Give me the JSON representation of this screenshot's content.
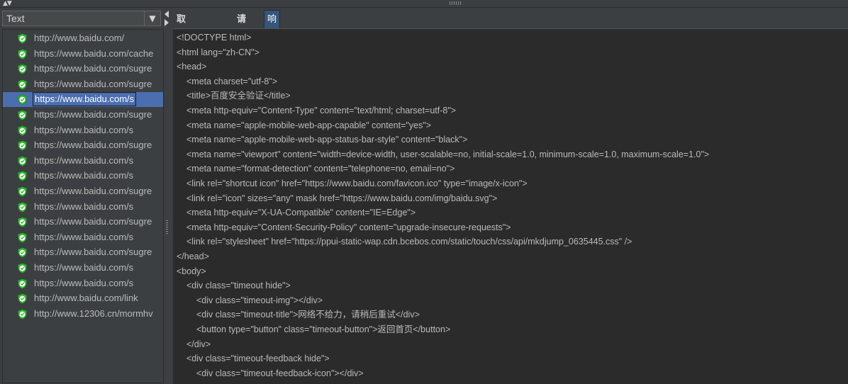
{
  "left_panel": {
    "renderer_select": {
      "value": "Text"
    },
    "results": [
      {
        "label": "http://www.baidu.com/"
      },
      {
        "label": "https://www.baidu.com/cache"
      },
      {
        "label": "https://www.baidu.com/sugre"
      },
      {
        "label": "https://www.baidu.com/sugre"
      },
      {
        "label": "https://www.baidu.com/s",
        "selected": true
      },
      {
        "label": "https://www.baidu.com/sugre"
      },
      {
        "label": "https://www.baidu.com/s"
      },
      {
        "label": "https://www.baidu.com/sugre"
      },
      {
        "label": "https://www.baidu.com/s"
      },
      {
        "label": "https://www.baidu.com/s"
      },
      {
        "label": "https://www.baidu.com/sugre"
      },
      {
        "label": "https://www.baidu.com/s"
      },
      {
        "label": "https://www.baidu.com/sugre"
      },
      {
        "label": "https://www.baidu.com/s"
      },
      {
        "label": "https://www.baidu.com/sugre"
      },
      {
        "label": "https://www.baidu.com/s"
      },
      {
        "label": "https://www.baidu.com/s"
      },
      {
        "label": "http://www.baidu.com/link"
      },
      {
        "label": "http://www.12306.cn/mormhv"
      }
    ],
    "success_icon": "green-shield-check-icon"
  },
  "tabs": [
    {
      "label": "取样器结果"
    },
    {
      "label": "请求"
    },
    {
      "label": "响应数据",
      "active": true
    }
  ],
  "response_lines": [
    {
      "indent": 0,
      "text": "<!DOCTYPE html>"
    },
    {
      "indent": 0,
      "text": "<html lang=\"zh-CN\">"
    },
    {
      "indent": 0,
      "text": "<head>"
    },
    {
      "indent": 1,
      "text": "<meta charset=\"utf-8\">"
    },
    {
      "indent": 1,
      "text": "<title>百度安全验证</title>"
    },
    {
      "indent": 1,
      "text": "<meta http-equiv=\"Content-Type\" content=\"text/html; charset=utf-8\">"
    },
    {
      "indent": 1,
      "text": "<meta name=\"apple-mobile-web-app-capable\" content=\"yes\">"
    },
    {
      "indent": 1,
      "text": "<meta name=\"apple-mobile-web-app-status-bar-style\" content=\"black\">"
    },
    {
      "indent": 1,
      "text": "<meta name=\"viewport\" content=\"width=device-width, user-scalable=no, initial-scale=1.0, minimum-scale=1.0, maximum-scale=1.0\">"
    },
    {
      "indent": 1,
      "text": "<meta name=\"format-detection\" content=\"telephone=no, email=no\">"
    },
    {
      "indent": 1,
      "text": "<link rel=\"shortcut icon\" href=\"https://www.baidu.com/favicon.ico\" type=\"image/x-icon\">"
    },
    {
      "indent": 1,
      "text": "<link rel=\"icon\" sizes=\"any\" mask href=\"https://www.baidu.com/img/baidu.svg\">"
    },
    {
      "indent": 1,
      "text": "<meta http-equiv=\"X-UA-Compatible\" content=\"IE=Edge\">"
    },
    {
      "indent": 1,
      "text": "<meta http-equiv=\"Content-Security-Policy\" content=\"upgrade-insecure-requests\">"
    },
    {
      "indent": 1,
      "text": "<link rel=\"stylesheet\" href=\"https://ppui-static-wap.cdn.bcebos.com/static/touch/css/api/mkdjump_0635445.css\" />"
    },
    {
      "indent": 0,
      "text": "</head>"
    },
    {
      "indent": 0,
      "text": "<body>"
    },
    {
      "indent": 1,
      "text": "<div class=\"timeout hide\">"
    },
    {
      "indent": 2,
      "text": "<div class=\"timeout-img\"></div>"
    },
    {
      "indent": 2,
      "text": "<div class=\"timeout-title\">网络不给力，请稍后重试</div>"
    },
    {
      "indent": 2,
      "text": "<button type=\"button\" class=\"timeout-button\">返回首页</button>"
    },
    {
      "indent": 1,
      "text": "</div>"
    },
    {
      "indent": 1,
      "text": "<div class=\"timeout-feedback hide\">"
    },
    {
      "indent": 2,
      "text": "<div class=\"timeout-feedback-icon\"></div>"
    }
  ],
  "colors": {
    "panel_bg": "#3c3f41",
    "editor_bg": "#2b2b2b",
    "selection": "#4b6eaf",
    "active_tab": "#35557a",
    "success_green": "#2fb52f"
  }
}
